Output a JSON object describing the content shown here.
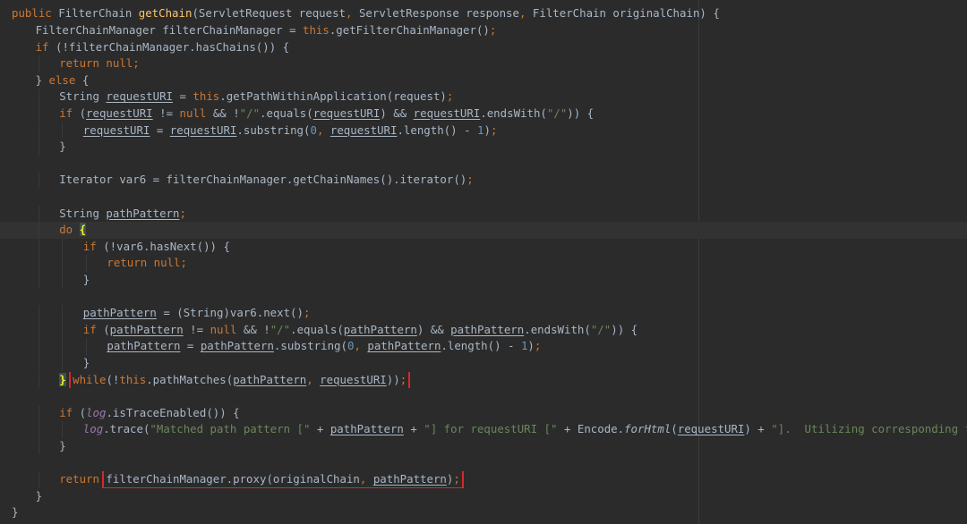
{
  "editor": {
    "lines": [
      {
        "indent": 0,
        "tokens": [
          {
            "t": "public ",
            "c": "kw"
          },
          {
            "t": "FilterChain "
          },
          {
            "t": "getChain",
            "c": "fn"
          },
          {
            "t": "(ServletRequest request"
          },
          {
            "t": ", ",
            "c": "kw"
          },
          {
            "t": "ServletResponse response"
          },
          {
            "t": ", ",
            "c": "kw"
          },
          {
            "t": "FilterChain originalChain) {"
          }
        ]
      },
      {
        "indent": 1,
        "tokens": [
          {
            "t": "FilterChainManager filterChainManager = "
          },
          {
            "t": "this",
            "c": "kw"
          },
          {
            "t": ".getFilterChainManager()"
          },
          {
            "t": ";",
            "c": "kw"
          }
        ]
      },
      {
        "indent": 1,
        "tokens": [
          {
            "t": "if ",
            "c": "kw"
          },
          {
            "t": "(!filterChainManager.hasChains()) {"
          }
        ]
      },
      {
        "indent": 2,
        "tokens": [
          {
            "t": "return null;",
            "c": "kw"
          }
        ]
      },
      {
        "indent": 1,
        "tokens": [
          {
            "t": "} "
          },
          {
            "t": "else ",
            "c": "kw"
          },
          {
            "t": "{"
          }
        ]
      },
      {
        "indent": 2,
        "tokens": [
          {
            "t": "String "
          },
          {
            "t": "requestURI",
            "c": "var"
          },
          {
            "t": " = "
          },
          {
            "t": "this",
            "c": "kw"
          },
          {
            "t": ".getPathWithinApplication(request)"
          },
          {
            "t": ";",
            "c": "kw"
          }
        ]
      },
      {
        "indent": 2,
        "tokens": [
          {
            "t": "if ",
            "c": "kw"
          },
          {
            "t": "("
          },
          {
            "t": "requestURI",
            "c": "var"
          },
          {
            "t": " != "
          },
          {
            "t": "null ",
            "c": "kw"
          },
          {
            "t": "&& !"
          },
          {
            "t": "\"/\"",
            "c": "str"
          },
          {
            "t": ".equals("
          },
          {
            "t": "requestURI",
            "c": "var"
          },
          {
            "t": ") && "
          },
          {
            "t": "requestURI",
            "c": "var"
          },
          {
            "t": ".endsWith("
          },
          {
            "t": "\"/\"",
            "c": "str"
          },
          {
            "t": ")) {"
          }
        ]
      },
      {
        "indent": 3,
        "tokens": [
          {
            "t": "requestURI",
            "c": "var"
          },
          {
            "t": " = "
          },
          {
            "t": "requestURI",
            "c": "var"
          },
          {
            "t": ".substring("
          },
          {
            "t": "0",
            "c": "num"
          },
          {
            "t": ", ",
            "c": "kw"
          },
          {
            "t": "requestURI",
            "c": "var"
          },
          {
            "t": ".length() - "
          },
          {
            "t": "1",
            "c": "num"
          },
          {
            "t": ")"
          },
          {
            "t": ";",
            "c": "kw"
          }
        ]
      },
      {
        "indent": 2,
        "tokens": [
          {
            "t": "}"
          }
        ]
      },
      {
        "indent": 0,
        "tokens": []
      },
      {
        "indent": 2,
        "tokens": [
          {
            "t": "Iterator var6 = filterChainManager.getChainNames().iterator()"
          },
          {
            "t": ";",
            "c": "kw"
          }
        ]
      },
      {
        "indent": 0,
        "tokens": []
      },
      {
        "indent": 2,
        "tokens": [
          {
            "t": "String "
          },
          {
            "t": "pathPattern",
            "c": "var"
          },
          {
            "t": ";",
            "c": "kw"
          }
        ]
      },
      {
        "indent": 2,
        "caret": true,
        "tokens": [
          {
            "t": "do ",
            "c": "kw"
          },
          {
            "t": "{",
            "c": "brace"
          }
        ]
      },
      {
        "indent": 3,
        "tokens": [
          {
            "t": "if ",
            "c": "kw"
          },
          {
            "t": "(!var6.hasNext()) {"
          }
        ]
      },
      {
        "indent": 4,
        "tokens": [
          {
            "t": "return null;",
            "c": "kw"
          }
        ]
      },
      {
        "indent": 3,
        "tokens": [
          {
            "t": "}"
          }
        ]
      },
      {
        "indent": 0,
        "tokens": []
      },
      {
        "indent": 3,
        "tokens": [
          {
            "t": "pathPattern",
            "c": "var"
          },
          {
            "t": " = (String)var6.next()"
          },
          {
            "t": ";",
            "c": "kw"
          }
        ]
      },
      {
        "indent": 3,
        "tokens": [
          {
            "t": "if ",
            "c": "kw"
          },
          {
            "t": "("
          },
          {
            "t": "pathPattern",
            "c": "var"
          },
          {
            "t": " != "
          },
          {
            "t": "null ",
            "c": "kw"
          },
          {
            "t": "&& !"
          },
          {
            "t": "\"/\"",
            "c": "str"
          },
          {
            "t": ".equals("
          },
          {
            "t": "pathPattern",
            "c": "var"
          },
          {
            "t": ") && "
          },
          {
            "t": "pathPattern",
            "c": "var"
          },
          {
            "t": ".endsWith("
          },
          {
            "t": "\"/\"",
            "c": "str"
          },
          {
            "t": ")) {"
          }
        ]
      },
      {
        "indent": 4,
        "tokens": [
          {
            "t": "pathPattern",
            "c": "var"
          },
          {
            "t": " = "
          },
          {
            "t": "pathPattern",
            "c": "var"
          },
          {
            "t": ".substring("
          },
          {
            "t": "0",
            "c": "num"
          },
          {
            "t": ", ",
            "c": "kw"
          },
          {
            "t": "pathPattern",
            "c": "var"
          },
          {
            "t": ".length() - "
          },
          {
            "t": "1",
            "c": "num"
          },
          {
            "t": ")"
          },
          {
            "t": ";",
            "c": "kw"
          }
        ]
      },
      {
        "indent": 3,
        "tokens": [
          {
            "t": "}"
          }
        ]
      },
      {
        "indent": 2,
        "tokens": [
          {
            "t": "}",
            "c": "brace"
          },
          {
            "t": " "
          },
          {
            "box": true,
            "tokens": [
              {
                "t": "while",
                "c": "kw"
              },
              {
                "t": "(!"
              },
              {
                "t": "this",
                "c": "kw"
              },
              {
                "t": ".pathMatches("
              },
              {
                "t": "pathPattern",
                "c": "var"
              },
              {
                "t": ", ",
                "c": "kw"
              },
              {
                "t": "requestURI",
                "c": "var"
              },
              {
                "t": "))"
              },
              {
                "t": ";",
                "c": "kw"
              }
            ]
          }
        ]
      },
      {
        "indent": 0,
        "tokens": []
      },
      {
        "indent": 2,
        "tokens": [
          {
            "t": "if ",
            "c": "kw"
          },
          {
            "t": "("
          },
          {
            "t": "log",
            "c": "field"
          },
          {
            "t": ".isTraceEnabled()) {"
          }
        ]
      },
      {
        "indent": 3,
        "tokens": [
          {
            "t": "log",
            "c": "field"
          },
          {
            "t": ".trace("
          },
          {
            "t": "\"Matched path pattern [\" ",
            "c": "str"
          },
          {
            "t": "+ "
          },
          {
            "t": "pathPattern",
            "c": "var"
          },
          {
            "t": " + "
          },
          {
            "t": "\"] for requestURI [\" ",
            "c": "str"
          },
          {
            "t": "+ Encode."
          },
          {
            "t": "forHtml",
            "c": "smeth"
          },
          {
            "t": "("
          },
          {
            "t": "requestURI",
            "c": "var"
          },
          {
            "t": ") + "
          },
          {
            "t": "\"].  Utilizing corresponding filter chain...\"",
            "c": "str"
          },
          {
            "t": ")"
          },
          {
            "t": ";",
            "c": "kw"
          }
        ]
      },
      {
        "indent": 2,
        "tokens": [
          {
            "t": "}"
          }
        ]
      },
      {
        "indent": 0,
        "tokens": []
      },
      {
        "indent": 2,
        "tokens": [
          {
            "t": "return ",
            "c": "kw"
          },
          {
            "box": true,
            "tokens": [
              {
                "t": "filterChainManager.proxy(originalChain"
              },
              {
                "t": ", ",
                "c": "kw"
              },
              {
                "t": "pathPattern",
                "c": "var"
              },
              {
                "t": ")"
              },
              {
                "t": ";",
                "c": "kw"
              }
            ]
          }
        ]
      },
      {
        "indent": 1,
        "tokens": [
          {
            "t": "}"
          }
        ]
      },
      {
        "indent": 0,
        "tokens": [
          {
            "t": "}"
          }
        ]
      }
    ]
  },
  "colors": {
    "background": "#2b2b2b",
    "keyword": "#cc7832",
    "method_declaration": "#ffc66d",
    "string": "#6a8759",
    "number": "#6897bb",
    "field": "#9876aa",
    "default_text": "#a9b7c6",
    "highlight_box": "#d7262c"
  }
}
